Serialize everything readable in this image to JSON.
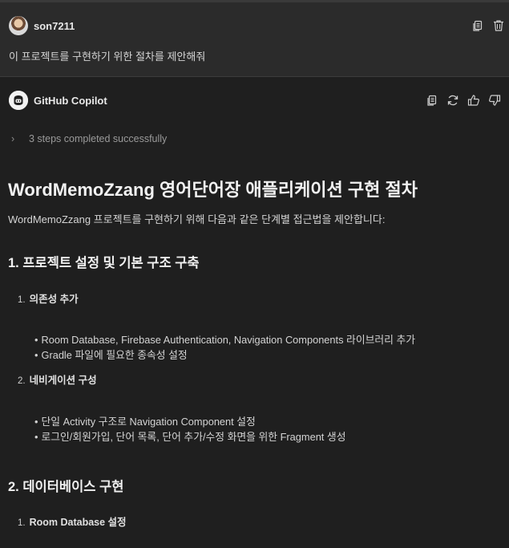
{
  "user": {
    "name": "son7211",
    "message": "이 프로젝트를 구현하기 위한 절차를 제안해줘",
    "actions": [
      "copy-icon",
      "trash-icon"
    ]
  },
  "assistant": {
    "name": "GitHub Copilot",
    "actions": [
      "copy-icon",
      "retry-icon",
      "thumbs-up-icon",
      "thumbs-down-icon"
    ],
    "steps_summary": "3 steps completed successfully"
  },
  "content": {
    "title": "WordMemoZzang 영어단어장 애플리케이션 구현 절차",
    "intro": "WordMemoZzang 프로젝트를 구현하기 위해 다음과 같은 단계별 접근법을 제안합니다:",
    "sections": [
      {
        "heading": "1. 프로젝트 설정 및 기본 구조 구축",
        "subsections": [
          {
            "num": "1.",
            "label": "의존성 추가",
            "bullets": [
              "Room Database, Firebase Authentication, Navigation Components 라이브러리 추가",
              "Gradle 파일에 필요한 종속성 설정"
            ]
          },
          {
            "num": "2.",
            "label": "네비게이션 구성",
            "bullets": [
              "단일 Activity 구조로 Navigation Component 설정",
              "로그인/회원가입, 단어 목록, 단어 추가/수정 화면을 위한 Fragment 생성"
            ]
          }
        ]
      },
      {
        "heading": "2. 데이터베이스 구현",
        "subsections": [
          {
            "num": "1.",
            "label": "Room Database 설정",
            "bullets": []
          }
        ]
      }
    ]
  }
}
